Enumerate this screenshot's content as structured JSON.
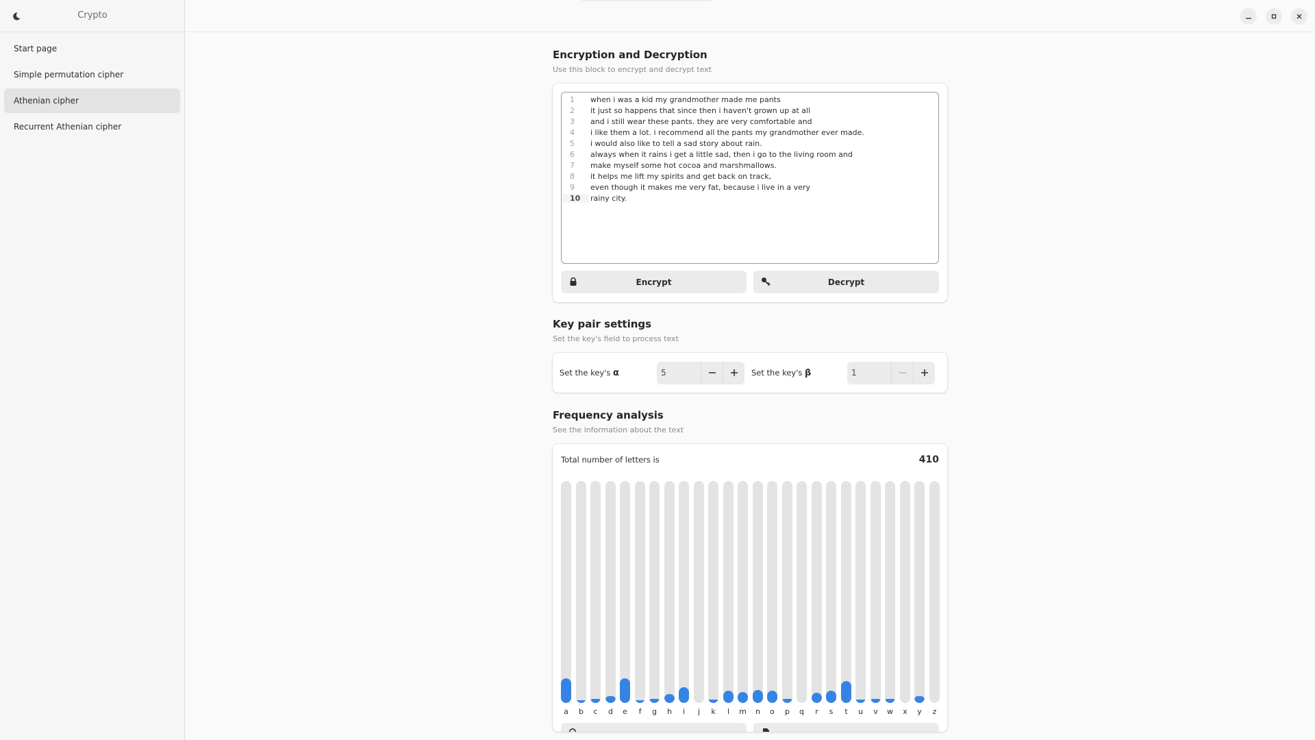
{
  "app": {
    "title": "Crypto"
  },
  "sidebar": {
    "items": [
      {
        "label": "Start page",
        "active": false
      },
      {
        "label": "Simple permutation cipher",
        "active": false
      },
      {
        "label": "Athenian cipher",
        "active": true
      },
      {
        "label": "Recurrent Athenian cipher",
        "active": false
      }
    ]
  },
  "encryption": {
    "title": "Encryption and Decryption",
    "subtitle": "Use this block to encrypt and decrypt text",
    "lines": [
      "when i was a kid my grandmother made me pants",
      "it just so happens that since then i haven't grown up at all",
      "and i still wear these pants. they are very comfortable and",
      "i like them a lot. i recommend all the pants my grandmother ever made.",
      "i would also like to tell a sad story about rain.",
      "always when it rains i get a little sad, then i go to the living room and",
      "make myself some hot cocoa and marshmallows.",
      "it helps me lift my spirits and get back on track,",
      "even though it makes me very fat, because i live in a very",
      "rainy city."
    ],
    "current_line": 10,
    "encrypt_label": "Encrypt",
    "decrypt_label": "Decrypt"
  },
  "keys": {
    "title": "Key pair settings",
    "subtitle": "Set the key's field to process text",
    "alpha_label": "Set the key's ",
    "alpha_symbol": "α",
    "alpha_value": "5",
    "beta_label": "Set the key's ",
    "beta_symbol": "β",
    "beta_value": "1"
  },
  "frequency": {
    "title": "Frequency analysis",
    "subtitle": "See the information about the text",
    "total_label": "Total number of letters is",
    "total_value": "410",
    "letters": [
      "a",
      "b",
      "c",
      "d",
      "e",
      "f",
      "g",
      "h",
      "i",
      "j",
      "k",
      "l",
      "m",
      "n",
      "o",
      "p",
      "q",
      "r",
      "s",
      "t",
      "u",
      "v",
      "w",
      "x",
      "y",
      "z"
    ],
    "fill_fractions": [
      0.11,
      0.008,
      0.02,
      0.03,
      0.11,
      0.008,
      0.02,
      0.04,
      0.07,
      0,
      0.015,
      0.055,
      0.05,
      0.06,
      0.055,
      0.02,
      0,
      0.045,
      0.055,
      0.1,
      0.015,
      0.02,
      0.02,
      0,
      0.03,
      0
    ]
  },
  "colors": {
    "accent": "#3584e4",
    "track": "#e3e3e3"
  }
}
